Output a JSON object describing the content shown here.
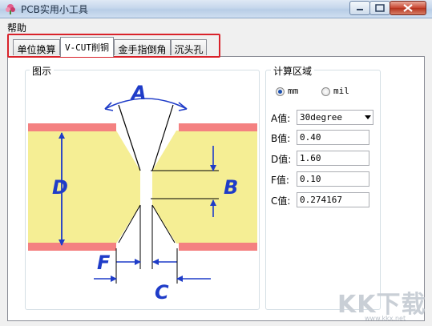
{
  "window": {
    "title": "PCB实用小工具"
  },
  "menu": {
    "help": "帮助"
  },
  "tabs": [
    {
      "label": "单位换算",
      "active": false
    },
    {
      "label": "V-CUT削铜",
      "active": true
    },
    {
      "label": "金手指倒角",
      "active": false
    },
    {
      "label": "沉头孔",
      "active": false
    }
  ],
  "diagram": {
    "title": "图示",
    "labels": {
      "a": "A",
      "b": "B",
      "c": "C",
      "d": "D",
      "f": "F"
    },
    "colors": {
      "board": "#f5ee94",
      "copper": "#f48181",
      "dimension": "#1f3cc8"
    }
  },
  "calc": {
    "title": "计算区域",
    "unit_mm": "mm",
    "unit_mil": "mil",
    "selected_unit": "mm",
    "a_label": "A值:",
    "a_value": "30degree",
    "b_label": "B值:",
    "b_value": "0.40",
    "d_label": "D值:",
    "d_value": "1.60",
    "f_label": "F值:",
    "f_value": "0.10",
    "c_label": "C值:",
    "c_value": "0.274167"
  },
  "watermark": {
    "text": "KK下载",
    "url": "www.kkx.net"
  }
}
